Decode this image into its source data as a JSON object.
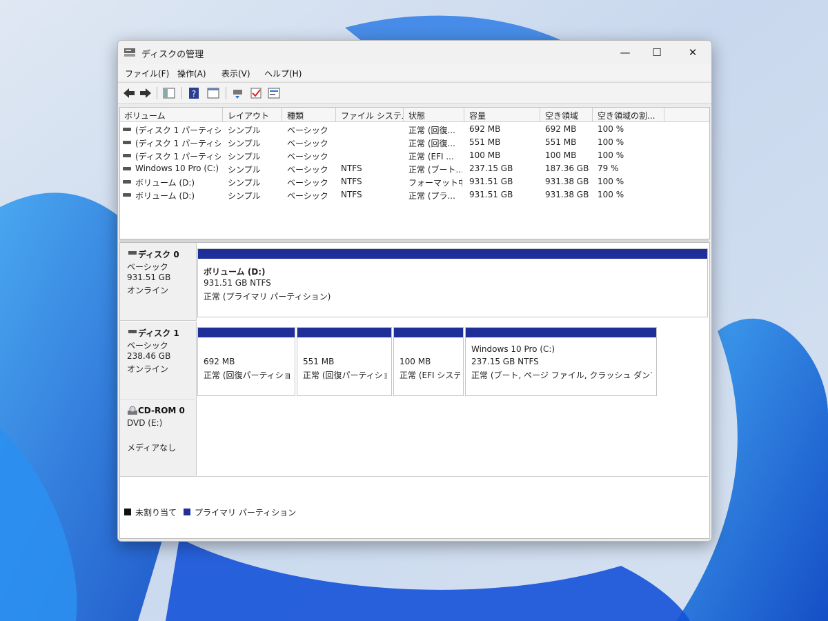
{
  "window": {
    "title": "ディスクの管理",
    "controls": {
      "minimize": "—",
      "maximize": "☐",
      "close": "✕"
    }
  },
  "menu": [
    "ファイル(F)",
    "操作(A)",
    "表示(V)",
    "ヘルプ(H)"
  ],
  "toolbar_icons": [
    "back-icon",
    "forward-icon",
    "console-tree-icon",
    "help-icon",
    "properties-icon",
    "connect-disk-icon",
    "check-icon",
    "settings-list-icon"
  ],
  "volume_list": {
    "columns": [
      "ボリューム",
      "レイアウト",
      "種類",
      "ファイル システム",
      "状態",
      "容量",
      "空き領域",
      "空き領域の割..."
    ],
    "rows": [
      [
        "(ディスク 1 パーティシ...",
        "シンプル",
        "ベーシック",
        "",
        "正常 (回復...",
        "692 MB",
        "692 MB",
        "100 %"
      ],
      [
        "(ディスク 1 パーティシ...",
        "シンプル",
        "ベーシック",
        "",
        "正常 (回復...",
        "551 MB",
        "551 MB",
        "100 %"
      ],
      [
        "(ディスク 1 パーティシ...",
        "シンプル",
        "ベーシック",
        "",
        "正常 (EFI ...",
        "100 MB",
        "100 MB",
        "100 %"
      ],
      [
        "Windows 10 Pro (C:)",
        "シンプル",
        "ベーシック",
        "NTFS",
        "正常 (ブート...",
        "237.15 GB",
        "187.36 GB",
        "79 %"
      ],
      [
        "ボリューム (D:)",
        "シンプル",
        "ベーシック",
        "NTFS",
        "フォーマット中",
        "931.51 GB",
        "931.38 GB",
        "100 %"
      ],
      [
        "ボリューム (D:)",
        "シンプル",
        "ベーシック",
        "NTFS",
        "正常 (プラ...",
        "931.51 GB",
        "931.38 GB",
        "100 %"
      ]
    ]
  },
  "disks": [
    {
      "name": "ディスク 0",
      "type": "ベーシック",
      "size": "931.51 GB",
      "status": "オンライン",
      "partitions": [
        {
          "name": "ボリューム (D:)",
          "size": "931.51 GB NTFS",
          "status": "正常 (プライマリ パーティション)"
        }
      ]
    },
    {
      "name": "ディスク 1",
      "type": "ベーシック",
      "size": "238.46 GB",
      "status": "オンライン",
      "partitions": [
        {
          "name": "",
          "size": "692 MB",
          "status": "正常 (回復パーティション)"
        },
        {
          "name": "",
          "size": "551 MB",
          "status": "正常 (回復パーティション)"
        },
        {
          "name": "",
          "size": "100 MB",
          "status": "正常 (EFI システム パーティション)"
        },
        {
          "name": "Windows 10 Pro (C:)",
          "size": "237.15 GB NTFS",
          "status": "正常 (ブート, ページ ファイル, クラッシュ ダンプ, ベーシック データ パーティション)"
        }
      ]
    }
  ],
  "cdrom": {
    "name": "CD-ROM 0",
    "type": "DVD (E:)",
    "status": "メディアなし"
  },
  "legend": [
    {
      "label": "未割り当て",
      "color": "#111111"
    },
    {
      "label": "プライマリ パーティション",
      "color": "#1f2f9a"
    }
  ],
  "colors": {
    "partition_bar": "#1f2f9a",
    "wallpaper": "#1f5fc4"
  }
}
